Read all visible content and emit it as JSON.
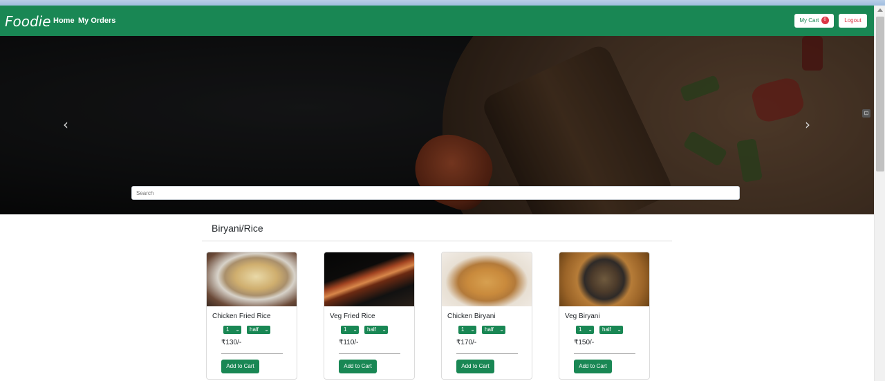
{
  "navbar": {
    "brand": "Foodie",
    "links": [
      "Home",
      "My Orders"
    ],
    "cart_label": "My Cart",
    "cart_count": "0",
    "logout_label": "Logout",
    "color": "#198754"
  },
  "carousel": {
    "prev_icon": "chevron-left-icon",
    "next_icon": "chevron-right-icon",
    "search_placeholder": "Search"
  },
  "section": {
    "title": "Biryani/Rice"
  },
  "items": [
    {
      "name": "Chicken Fried Rice",
      "qty": "1",
      "size": "half",
      "price": "₹130/-",
      "button": "Add to Cart"
    },
    {
      "name": "Veg Fried Rice",
      "qty": "1",
      "size": "half",
      "price": "₹110/-",
      "button": "Add to Cart"
    },
    {
      "name": "Chicken Biryani",
      "qty": "1",
      "size": "half",
      "price": "₹170/-",
      "button": "Add to Cart"
    },
    {
      "name": "Veg Biryani",
      "qty": "1",
      "size": "half",
      "price": "₹150/-",
      "button": "Add to Cart"
    }
  ]
}
